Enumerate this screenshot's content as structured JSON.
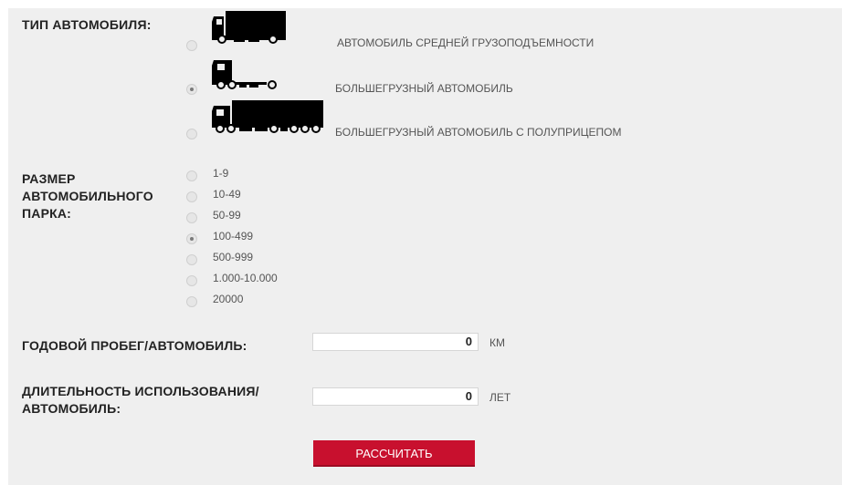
{
  "vehicle_type": {
    "label": "ТИП АВТОМОБИЛЯ:",
    "options": [
      {
        "label": "АВТОМОБИЛЬ СРЕДНЕЙ ГРУЗОПОДЪЕМНОСТИ",
        "icon": "medium-truck-icon",
        "selected": false
      },
      {
        "label": "БОЛЬШЕГРУЗНЫЙ АВТОМОБИЛЬ",
        "icon": "heavy-truck-icon",
        "selected": true
      },
      {
        "label": "БОЛЬШЕГРУЗНЫЙ АВТОМОБИЛЬ С ПОЛУПРИЦЕПОМ",
        "icon": "semi-trailer-truck-icon",
        "selected": false
      }
    ]
  },
  "fleet_size": {
    "label_lines": [
      "РАЗМЕР",
      "АВТОМОБИЛЬНОГО",
      "ПАРКА:"
    ],
    "options": [
      {
        "label": "1-9",
        "selected": false
      },
      {
        "label": "10-49",
        "selected": false
      },
      {
        "label": "50-99",
        "selected": false
      },
      {
        "label": "100-499",
        "selected": true
      },
      {
        "label": "500-999",
        "selected": false
      },
      {
        "label": "1.000-10.000",
        "selected": false
      },
      {
        "label": "20000",
        "selected": false
      }
    ]
  },
  "annual_mileage": {
    "label": "ГОДОВОЙ ПРОБЕГ/АВТОМОБИЛЬ:",
    "value": "0",
    "unit": "КМ"
  },
  "usage_duration": {
    "label_lines": [
      "ДЛИТЕЛЬНОСТЬ ИСПОЛЬЗОВАНИЯ/",
      "АВТОМОБИЛЬ:"
    ],
    "value": "0",
    "unit": "ЛЕТ"
  },
  "calculate_button": {
    "label": "РАССЧИТАТЬ"
  },
  "colors": {
    "panel_bg": "#efefef",
    "accent": "#c8102e",
    "icon": "#000000"
  }
}
